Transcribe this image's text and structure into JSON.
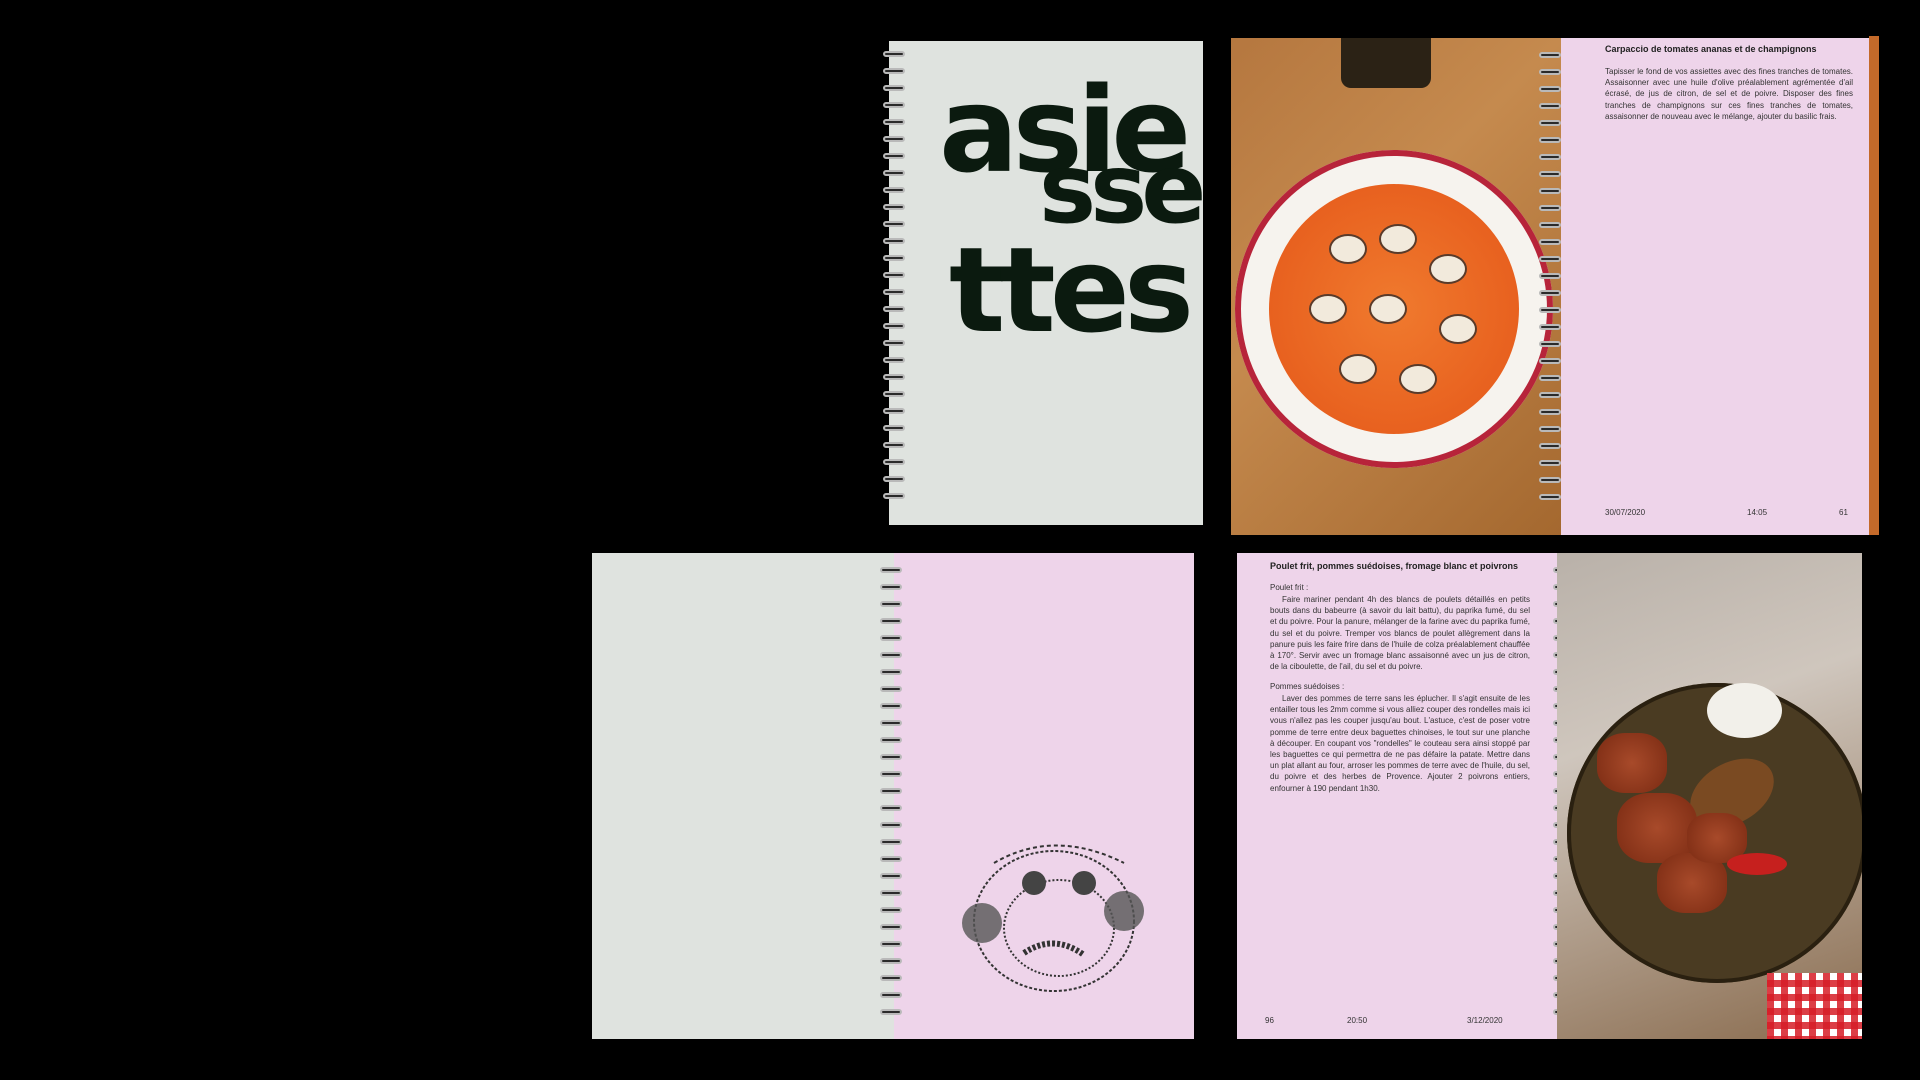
{
  "cover": {
    "title_lines": [
      "asie",
      "sse",
      "ttes"
    ],
    "accent_color": "#0b1a0f",
    "background_color": "#dfe3df"
  },
  "recipe1": {
    "title": "Carpaccio de tomates ananas et de champignons",
    "body": "Tapisser le fond de vos assiettes avec des fines tranches de tomates. Assaisonner avec une huile d'olive préalablement agrémentée d'ail écrasé, de jus de citron, de sel et de poivre. Disposer des fines tranches de champignons sur ces fines tranches de tomates, assaisonner de nouveau avec le mélange, ajouter du basilic frais.",
    "date": "30/07/2020",
    "time": "14:05",
    "page": "61"
  },
  "recipe2": {
    "title": "Poulet frit, pommes suédoises, fromage blanc et poivrons",
    "section1_heading": "Poulet frit :",
    "section1_body": "Faire mariner pendant 4h des blancs de poulets détaillés en petits bouts dans du babeurre (à savoir du lait battu), du paprika fumé, du sel et du poivre. Pour la panure, mélanger de la farine avec du paprika fumé, du sel et du poivre. Tremper vos blancs de poulet allègrement dans la panure puis les faire frire dans de l'huile de colza préalablement chauffée à 170°. Servir avec un fromage blanc assaisonné avec un jus de citron, de la ciboulette, de l'ail, du sel et du poivre.",
    "section2_heading": "Pommes suédoises :",
    "section2_body": "Laver des pommes de terre sans les éplucher. Il s'agit ensuite de les entailler tous les 2mm comme si vous alliez couper des rondelles mais ici vous n'allez pas les couper jusqu'au bout. L'astuce, c'est de poser votre pomme de terre entre deux baguettes chinoises, le tout sur une planche à découper. En coupant vos \"rondelles\" le couteau sera ainsi stoppé par les baguettes ce qui permettra de ne pas défaire la patate. Mettre dans un plat allant au four, arroser les pommes de terre avec de l'huile, du sel, du poivre et des herbes de Provence. Ajouter 2 poivrons entiers, enfourner à 190 pendant 1h30.",
    "page": "96",
    "time": "20:50",
    "date": "3/12/2020"
  },
  "colors": {
    "pink_paper": "#eed4ea",
    "grey_paper": "#dfe3df",
    "background": "#000000"
  }
}
